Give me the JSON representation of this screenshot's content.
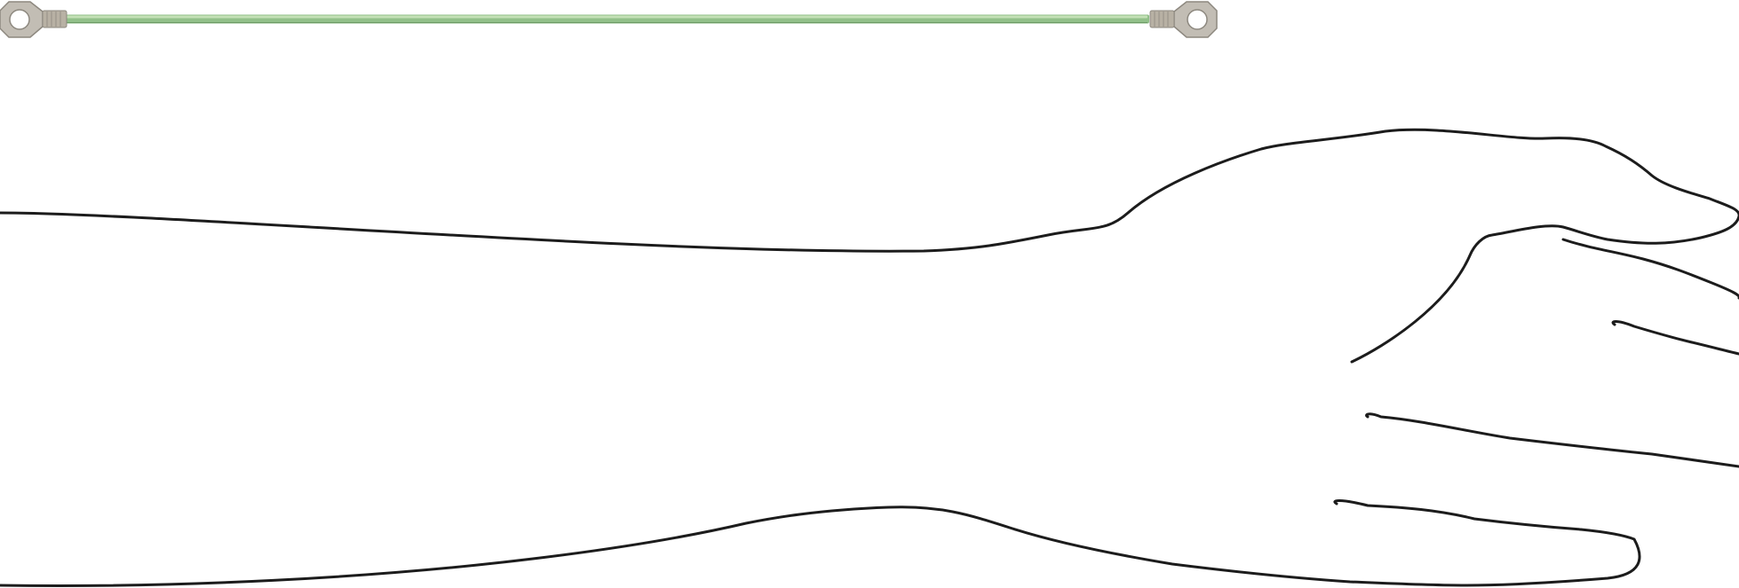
{
  "figure": {
    "cable": {
      "jacket_color": "#92c08a",
      "jacket_highlight": "#c4e0b6",
      "jacket_shadow": "#6c9a66",
      "lug_color": "#c2bdb4",
      "lug_edge": "#8d887f",
      "crimp_color": "#b8b1a4",
      "terminal_icon": "ring-terminal-icon"
    },
    "arm": {
      "stroke_color": "#1c1c1c",
      "icon": "hand-arm-outline-icon"
    }
  }
}
